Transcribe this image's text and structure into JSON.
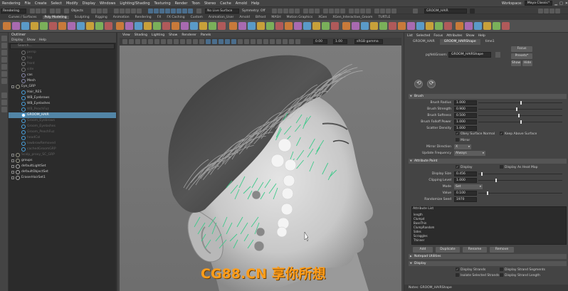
{
  "menubar": {
    "items": [
      "Rendering",
      "File",
      "Create",
      "Select",
      "Modify",
      "Display",
      "Windows",
      "Lighting/Shading",
      "Texturing",
      "Render",
      "Toon",
      "Stereo",
      "Cache",
      "Arnold",
      "Help"
    ],
    "workspace_label": "Workspace:",
    "workspace_value": "Maya Classic*"
  },
  "statusline": {
    "mode": "Rendering",
    "objects_label": "Objects",
    "live_surface": "No Live Surface",
    "symmetry": "Symmetry: Off",
    "node_field": "GROOM_HAIR"
  },
  "shelf": {
    "tabs": [
      "Curves / Surfaces",
      "Poly Modeling",
      "Sculpting",
      "Rigging",
      "Animation",
      "Rendering",
      "FX",
      "FX Caching",
      "Custom",
      "Animation_User",
      "Arnold",
      "Bifrost",
      "MASH",
      "Motion Graphics",
      "XGen",
      "XGen_Interactive_Groom",
      "TURTLE"
    ],
    "active_tab": "Poly Modeling"
  },
  "outliner": {
    "title": "Outliner",
    "menu": [
      "Display",
      "Show",
      "Help"
    ],
    "search_placeholder": "Search...",
    "items": [
      {
        "label": "persp",
        "indent": 1,
        "dim": true,
        "icon": "camera"
      },
      {
        "label": "top",
        "indent": 1,
        "dim": true,
        "icon": "camera"
      },
      {
        "label": "front",
        "indent": 1,
        "dim": true,
        "icon": "camera"
      },
      {
        "label": "side",
        "indent": 1,
        "dim": true,
        "icon": "camera"
      },
      {
        "label": "cas",
        "indent": 1,
        "dim": false,
        "icon": "mesh"
      },
      {
        "label": "Mesh",
        "indent": 1,
        "dim": false,
        "icon": "mesh"
      },
      {
        "label": "Eye_GRP",
        "indent": 0,
        "dim": false,
        "icon": "group"
      },
      {
        "label": "Hair_RES",
        "indent": 1,
        "dim": false,
        "icon": "xgen"
      },
      {
        "label": "WB_Eyebrows",
        "indent": 1,
        "dim": false,
        "icon": "xgen"
      },
      {
        "label": "WB_Eyelashes",
        "indent": 1,
        "dim": false,
        "icon": "xgen"
      },
      {
        "label": "WB_PeachFuz",
        "indent": 1,
        "dim": true,
        "icon": "xgen"
      },
      {
        "label": "GROOM_HAIR",
        "indent": 1,
        "dim": false,
        "icon": "xgen",
        "selected": true
      },
      {
        "label": "Groom_Eyebrows",
        "indent": 1,
        "dim": true,
        "icon": "curve"
      },
      {
        "label": "Groom_Eyelashes",
        "indent": 1,
        "dim": true,
        "icon": "curve"
      },
      {
        "label": "Groom_PeachFuz",
        "indent": 1,
        "dim": true,
        "icon": "curve"
      },
      {
        "label": "headCol",
        "indent": 1,
        "dim": true,
        "icon": "curve"
      },
      {
        "label": "lowbrowRemoved",
        "indent": 1,
        "dim": true,
        "icon": "curve"
      },
      {
        "label": "cachedGroomGRP",
        "indent": 1,
        "dim": true,
        "icon": "curve"
      },
      {
        "label": "Scalp_proxy_SC_GRP",
        "indent": 0,
        "dim": true,
        "icon": "group"
      },
      {
        "label": "groups",
        "indent": 0,
        "dim": false,
        "icon": "group"
      },
      {
        "label": "defaultLightSet",
        "indent": 0,
        "dim": false,
        "icon": "set"
      },
      {
        "label": "defaultObjectSet",
        "indent": 0,
        "dim": false,
        "icon": "set"
      },
      {
        "label": "EraserHairSet1",
        "indent": 0,
        "dim": false,
        "icon": "set"
      }
    ]
  },
  "viewport": {
    "menu": [
      "View",
      "Shading",
      "Lighting",
      "Show",
      "Renderer",
      "Panels"
    ],
    "field_a": "0.00",
    "field_b": "1.00",
    "color_space": "sRGB gamma"
  },
  "watermark": "CG88.CN 享你所想",
  "attribute_editor": {
    "menu": [
      "List",
      "Selected",
      "Focus",
      "Attributes",
      "Show",
      "Help"
    ],
    "tabs": [
      "GROOM_HAIR",
      "GROOM_HAIRShape",
      "time1"
    ],
    "active_tab": "GROOM_HAIRShape",
    "node_label": "pgYetiGroom:",
    "node_value": "GROOM_HAIRShape",
    "buttons": {
      "focus": "Focus",
      "presets": "Presets*",
      "show": "Show",
      "hide": "Hide"
    },
    "sections": {
      "brush": "Brush",
      "attribute_paint": "Attribute Paint",
      "notepad": "Notepad Utilities",
      "display": "Display"
    },
    "brush": {
      "radius_label": "Brush Radius",
      "radius": "1.000",
      "strength_label": "Brush Strength",
      "strength": "0.900",
      "softness_label": "Brush Softness",
      "softness": "0.500",
      "falloff_label": "Brush Falloff Power",
      "falloff": "1.000",
      "scatter_label": "Scatter Density",
      "scatter": "1.000",
      "obey_label": "Obey Surface Normal",
      "keep_label": "Keep Above Surface",
      "mirror_check": "Mirror",
      "mirror_dir_label": "Mirror Direction",
      "mirror_dir": "X",
      "update_label": "Update Frequency",
      "update": "Always"
    },
    "paint": {
      "display_label": "Display",
      "display_heat_label": "Display As Heat Map",
      "size_label": "Display Size",
      "size": "0.456",
      "clip_label": "Clipping Level",
      "clip": "1.000",
      "mode_label": "Mode",
      "mode": "Set",
      "value_label": "Value",
      "value": "0.100",
      "rseed_label": "Randomize Seed",
      "rseed": "1970",
      "list_label": "Attribute List",
      "list": [
        "length",
        "Clumpd",
        "BaseThin",
        "ClumpRandom",
        "Sides",
        "Scraggles",
        "Thinner"
      ],
      "add": "Add",
      "duplicate": "Duplicate",
      "rename": "Rename",
      "remove": "Remove"
    },
    "display": {
      "strands_label": "Display Strands",
      "strand_seg_label": "Display Strand Segments",
      "isolate_label": "Isolate Selected Strands",
      "strand_len_label": "Display Strand Length"
    },
    "notes_label": "Notes:",
    "notes_value": "GROOM_HAIRShape"
  }
}
